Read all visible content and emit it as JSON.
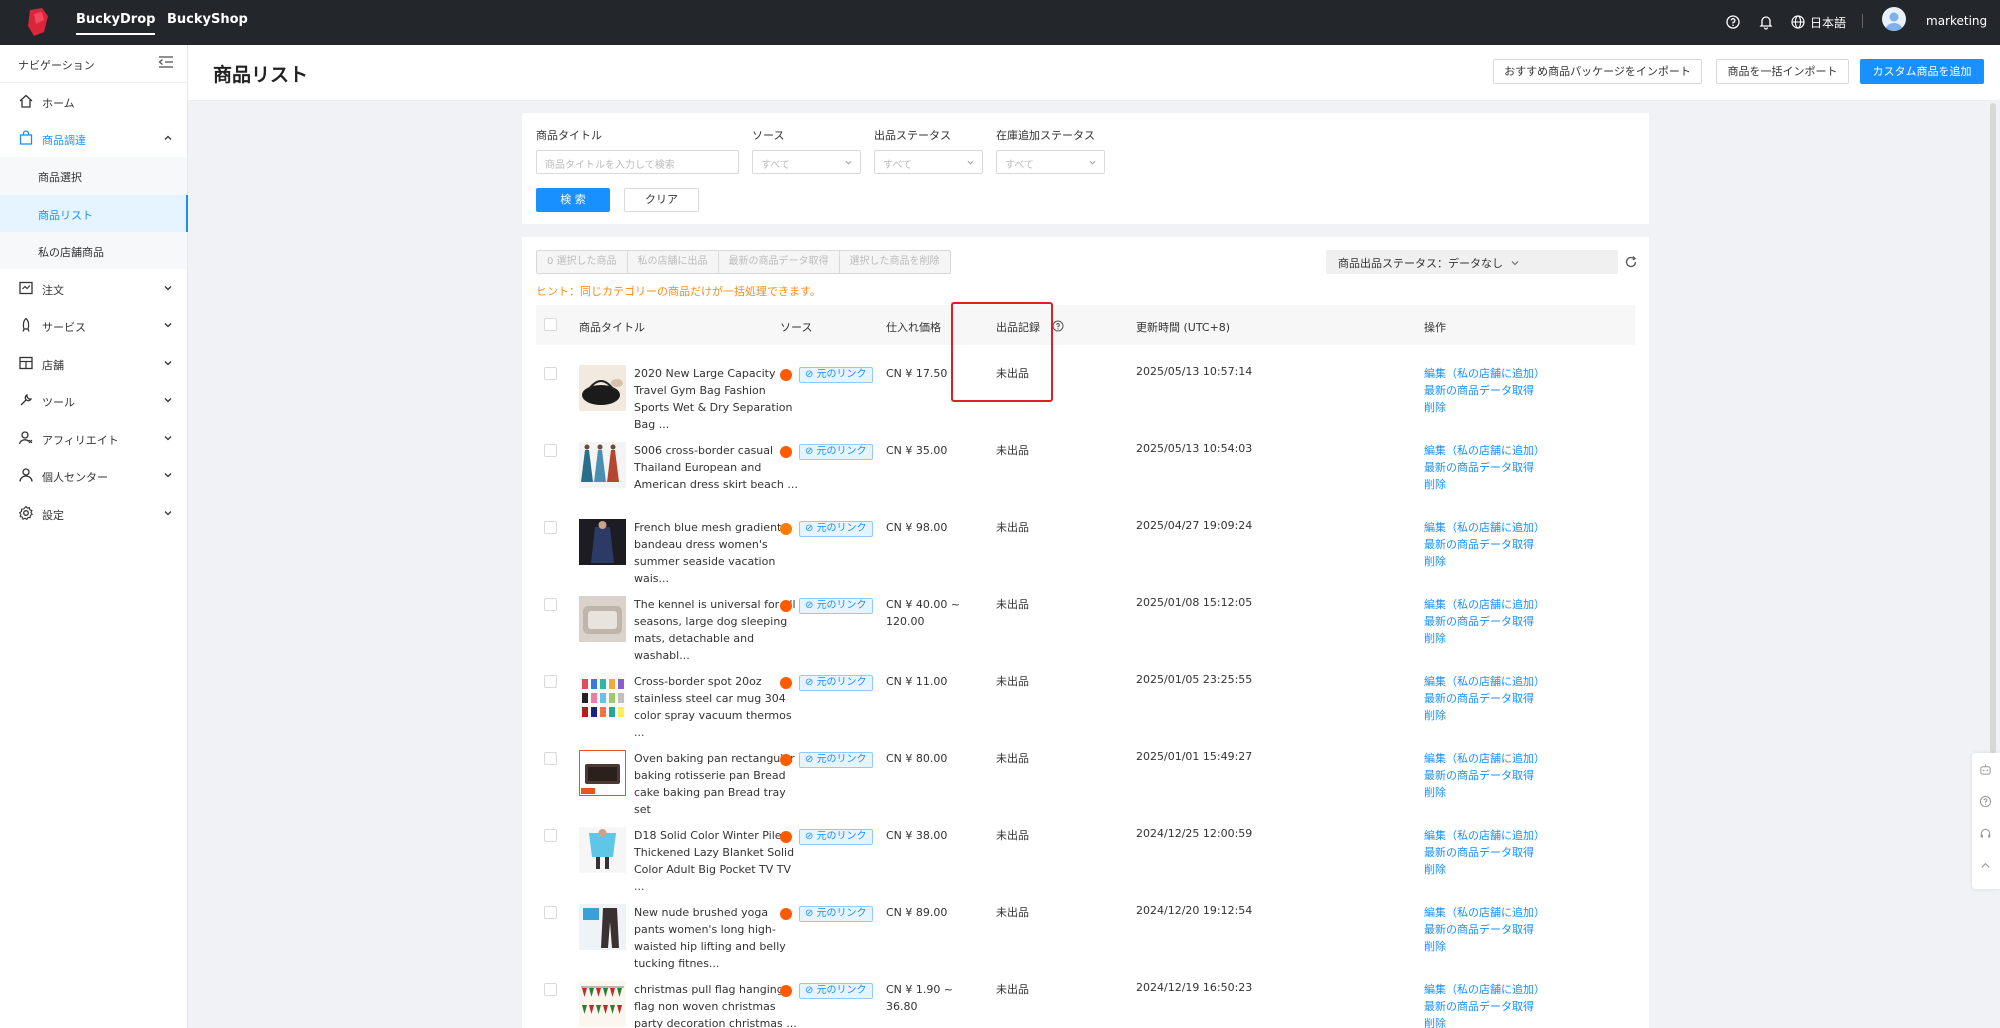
{
  "topbar": {
    "tabs": [
      "BuckyDrop",
      "BuckyShop"
    ],
    "language": "日本語",
    "username": "marketing"
  },
  "sidebar": {
    "header": "ナビゲーション",
    "items": [
      {
        "label": "ホーム",
        "icon": "home-icon"
      },
      {
        "label": "商品調達",
        "icon": "bag-icon"
      },
      {
        "label": "注文",
        "icon": "order-icon"
      },
      {
        "label": "サービス",
        "icon": "service-icon"
      },
      {
        "label": "店舗",
        "icon": "store-icon"
      },
      {
        "label": "ツール",
        "icon": "tool-icon"
      },
      {
        "label": "アフィリエイト",
        "icon": "affiliate-icon"
      },
      {
        "label": "個人センター",
        "icon": "user-icon"
      },
      {
        "label": "設定",
        "icon": "settings-icon"
      }
    ],
    "subitems": [
      "商品選択",
      "商品リスト",
      "私の店舗商品"
    ]
  },
  "header": {
    "title": "商品リスト",
    "buttons": [
      "おすすめ商品パッケージをインポート",
      "商品を一括インポート",
      "カスタム商品を追加"
    ]
  },
  "filters": {
    "labels": [
      "商品タイトル",
      "ソース",
      "出品ステータス",
      "在庫追加ステータス"
    ],
    "title_placeholder": "商品タイトルを入力して検索",
    "all_option": "すべて",
    "search_label": "検 索",
    "clear_label": "クリア"
  },
  "list": {
    "bulk_actions": [
      "0 選択した商品",
      "私の店舗に出品",
      "最新の商品データ取得",
      "選択した商品を削除"
    ],
    "status_filter": "商品出品ステータス：データなし",
    "hint": "ヒント：同じカテゴリーの商品だけが一括処理できます。",
    "columns": [
      "商品タイトル",
      "ソース",
      "仕入れ価格",
      "出品記録",
      "更新時間 (UTC+8)",
      "操作"
    ],
    "link_label": "元のリンク",
    "status_text": "未出品",
    "ops": [
      "編集（私の店舗に追加）",
      "最新の商品データ取得",
      "削除"
    ],
    "rows": [
      {
        "title": "2020 New Large Capacity Travel Gym Bag Fashion Sports Wet & Dry Separation Bag ...",
        "price": "CN ¥ 17.50",
        "time": "2025/05/13 10:57:14"
      },
      {
        "title": "S006 cross-border casual Thailand European and American dress skirt beach ...",
        "price": "CN ¥ 35.00",
        "time": "2025/05/13 10:54:03"
      },
      {
        "title": "French blue mesh gradient bandeau dress women's summer seaside vacation wais...",
        "price": "CN ¥ 98.00",
        "time": "2025/04/27 19:09:24"
      },
      {
        "title": "The kennel is universal for all seasons, large dog sleeping mats, detachable and washabl...",
        "price": "CN ¥ 40.00 ~ 120.00",
        "time": "2025/01/08 15:12:05"
      },
      {
        "title": "Cross-border spot 20oz stainless steel car mug 304 color spray vacuum thermos ...",
        "price": "CN ¥ 11.00",
        "time": "2025/01/05 23:25:55"
      },
      {
        "title": "Oven baking pan rectangular baking rotisserie pan Bread cake baking pan Bread tray set",
        "price": "CN ¥ 80.00",
        "time": "2025/01/01 15:49:27"
      },
      {
        "title": "D18 Solid Color Winter Pile Thickened Lazy Blanket Solid Color Adult Big Pocket TV TV ...",
        "price": "CN ¥ 38.00",
        "time": "2024/12/25 12:00:59"
      },
      {
        "title": "New nude brushed yoga pants women's long high-waisted hip lifting and belly tucking fitnes...",
        "price": "CN ¥ 89.00",
        "time": "2024/12/20 19:12:54"
      },
      {
        "title": "christmas pull flag hanging flag non woven christmas party decoration christmas ...",
        "price": "CN ¥ 1.90 ~ 36.80",
        "time": "2024/12/19 16:50:23"
      }
    ]
  },
  "colors": {
    "accent": "#1890ff",
    "topbar": "#23262b",
    "highlight": "#e02020",
    "hint": "#fa8c16"
  }
}
